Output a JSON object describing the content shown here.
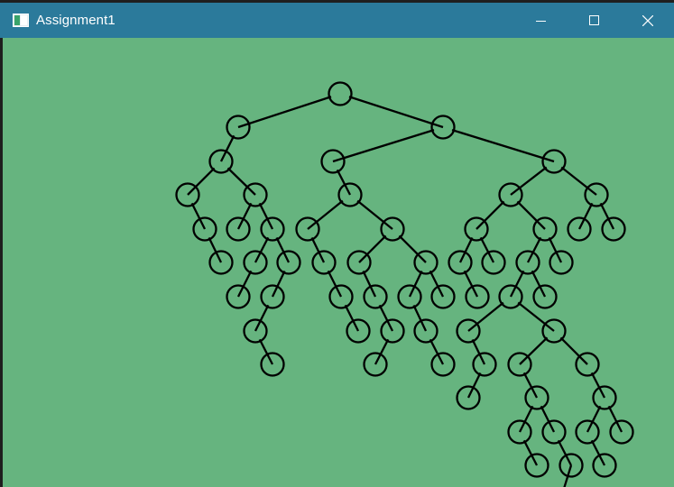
{
  "window": {
    "title": "Assignment1",
    "controls": [
      "minimize-icon",
      "maximize-icon",
      "close-icon"
    ]
  },
  "canvas": {
    "background": "#66b47f"
  },
  "colors": {
    "titlebar": "#2b7a9b",
    "title_text": "#ffffff",
    "node_stroke": "#000000"
  }
}
